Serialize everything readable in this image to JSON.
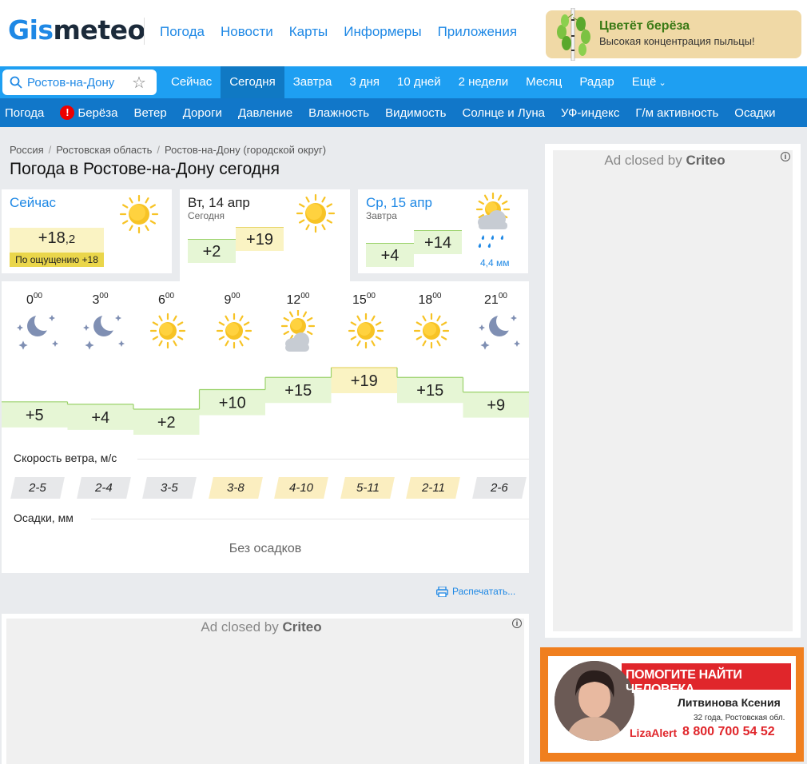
{
  "header": {
    "logo_part1": "Gis",
    "logo_part2": "meteo",
    "nav": [
      "Погода",
      "Новости",
      "Карты",
      "Информеры",
      "Приложения"
    ],
    "pollen_title": "Цветёт берёза",
    "pollen_text": "Высокая концентрация пыльцы!"
  },
  "search": {
    "city": "Ростов-на-Дону",
    "star": "☆"
  },
  "tabs": [
    {
      "label": "Сейчас",
      "active": false
    },
    {
      "label": "Сегодня",
      "active": true
    },
    {
      "label": "Завтра",
      "active": false
    },
    {
      "label": "3 дня",
      "active": false
    },
    {
      "label": "10 дней",
      "active": false
    },
    {
      "label": "2 недели",
      "active": false
    },
    {
      "label": "Месяц",
      "active": false
    },
    {
      "label": "Радар",
      "active": false
    },
    {
      "label": "Ещё",
      "active": false
    }
  ],
  "subnav": {
    "first": "Погода",
    "warn_mark": "!",
    "warn_label": "Берёза",
    "items": [
      "Ветер",
      "Дороги",
      "Давление",
      "Влажность",
      "Видимость",
      "Солнце и Луна",
      "УФ-индекс",
      "Г/м активность",
      "Осадки"
    ]
  },
  "breadcrumbs": [
    "Россия",
    "Ростовская область",
    "Ростов-на-Дону (городской округ)"
  ],
  "page_title": "Погода в Ростове-на-Дону сегодня",
  "now_card": {
    "title": "Сейчас",
    "temp_int": "+18",
    "temp_dec": ",2",
    "feels": "По ощущению +18"
  },
  "today_card": {
    "title": "Вт, 14 апр",
    "sub": "Сегодня",
    "low": "+2",
    "high": "+19"
  },
  "tomorrow_card": {
    "title": "Ср, 15 апр",
    "sub": "Завтра",
    "low": "+4",
    "high": "+14",
    "precip": "4,4 мм"
  },
  "hourly": {
    "hours": [
      "0",
      "3",
      "6",
      "9",
      "12",
      "15",
      "18",
      "21"
    ],
    "minutes": "00",
    "icons": [
      "moon",
      "moon",
      "sun",
      "sun",
      "sun-cloud",
      "sun",
      "sun",
      "moon"
    ],
    "temps": [
      "+5",
      "+4",
      "+2",
      "+10",
      "+15",
      "+19",
      "+15",
      "+9"
    ],
    "temp_values": [
      5,
      4,
      2,
      10,
      15,
      19,
      15,
      9
    ],
    "wind_label": "Скорость ветра, м/с",
    "wind": [
      "2-5",
      "2-4",
      "3-5",
      "3-8",
      "4-10",
      "5-11",
      "2-11",
      "2-6"
    ],
    "wind_level": [
      "low",
      "low",
      "low",
      "mid",
      "mid",
      "mid",
      "mid",
      "low"
    ],
    "precip_label": "Осадки, мм",
    "precip_value": "Без осадков"
  },
  "print_label": "Распечатать...",
  "ads": {
    "prefix": "Ad closed by ",
    "brand": "Criteo",
    "info": "i"
  },
  "lizaalert": {
    "headline": "ПОМОГИТЕ НАЙТИ ЧЕЛОВЕКА",
    "name": "Литвинова Ксения",
    "details": "32 года, Ростовская обл.",
    "brand": "LizaAlert",
    "phone": "8 800 700 54 52"
  },
  "colors": {
    "accent": "#1e9ff2",
    "nav_dark": "#1177c9",
    "warm": "#faf3c3",
    "cool": "#e6f6d5"
  }
}
